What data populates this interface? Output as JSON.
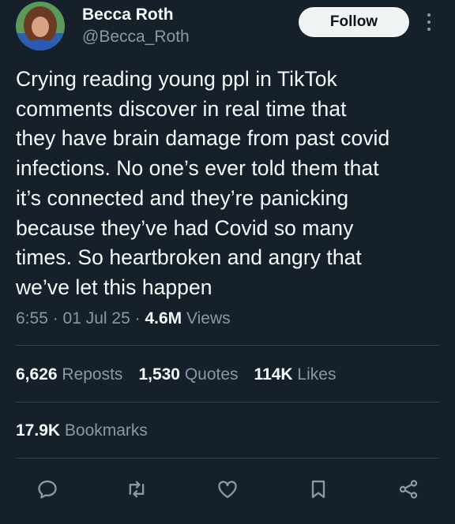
{
  "author": {
    "display_name": "Becca Roth",
    "handle": "@Becca_Roth"
  },
  "follow_button": {
    "label": "Follow"
  },
  "more_icon": "more-vertical-icon",
  "tweet": {
    "text": "Crying reading young ppl in TikTok\ncomments discover in real time that\nthey have brain damage from past covid\ninfections. No one’s ever told them that\nit’s connected and they’re panicking\nbecause they’ve had Covid so many\ntimes. So heartbroken and angry that\nwe’ve let this happen",
    "time": "6:55",
    "separator": " · ",
    "date": "01 Jul 25",
    "views_count": "4.6M",
    "views_label": " Views"
  },
  "stats": {
    "reposts_count": "6,626",
    "reposts_label": " Reposts",
    "quotes_count": "1,530",
    "quotes_label": " Quotes",
    "likes_count": "114K",
    "likes_label": " Likes",
    "bookmarks_count": "17.9K",
    "bookmarks_label": " Bookmarks"
  },
  "actions": [
    {
      "icon": "reply-icon"
    },
    {
      "icon": "repost-icon"
    },
    {
      "icon": "like-icon"
    },
    {
      "icon": "bookmark-icon"
    },
    {
      "icon": "share-icon"
    }
  ],
  "colors": {
    "background": "#15202b",
    "text_primary": "#f7f9f9",
    "text_secondary": "#8b98a5",
    "divider": "#38444d",
    "follow_bg": "#eff3f4"
  }
}
